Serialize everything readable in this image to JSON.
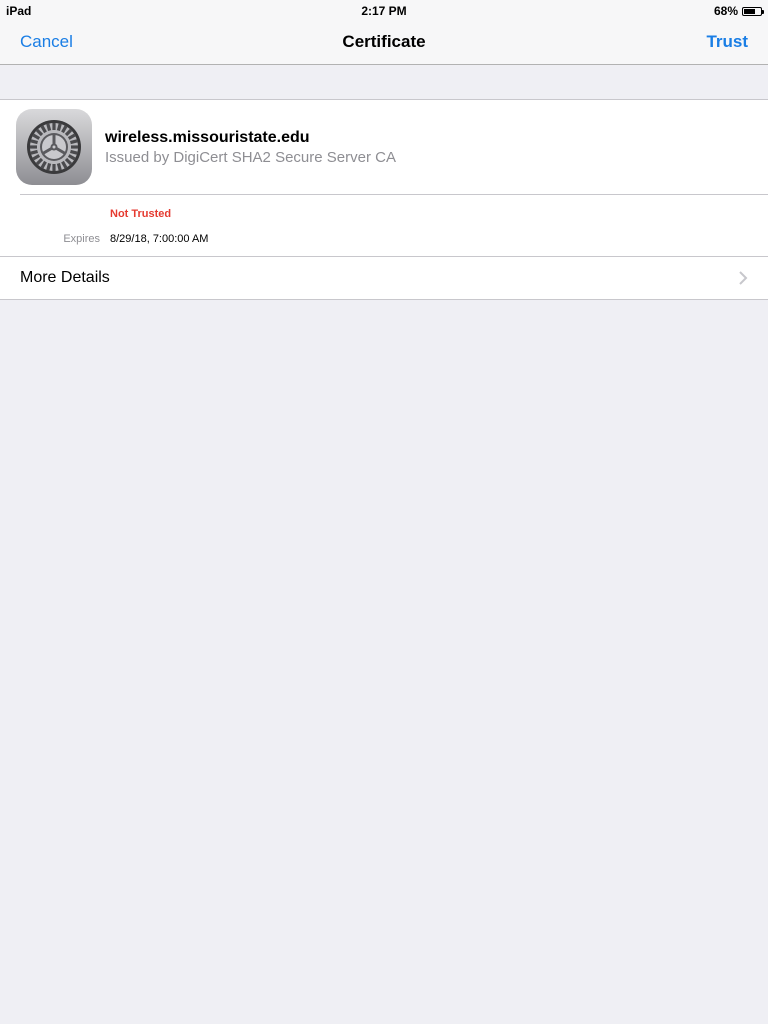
{
  "status_bar": {
    "device": "iPad",
    "time": "2:17 PM",
    "battery_text": "68%",
    "battery_level": 0.68
  },
  "nav": {
    "cancel": "Cancel",
    "title": "Certificate",
    "trust": "Trust",
    "accent_color": "#1a7ee5"
  },
  "certificate": {
    "icon": "settings-gear-icon",
    "name": "wireless.missouristate.edu",
    "issuer": "Issued by DigiCert SHA2 Secure Server CA",
    "trust_status": "Not Trusted",
    "trust_status_color": "#e53a30",
    "expires_label": "Expires",
    "expires_value": "8/29/18, 7:00:00 AM"
  },
  "more_details": {
    "label": "More Details",
    "icon": "chevron-right-icon"
  }
}
